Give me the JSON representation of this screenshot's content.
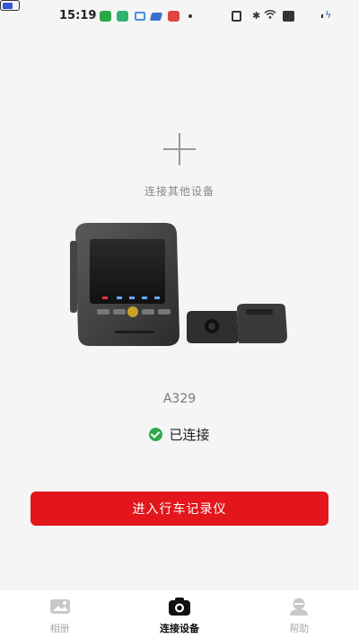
{
  "status_bar": {
    "time": "15:19"
  },
  "add_device": {
    "label": "连接其他设备"
  },
  "device": {
    "model": "A329",
    "status": "已连接"
  },
  "enter_button": {
    "label": "进入行车记录仪"
  },
  "tabs": [
    {
      "label": "相册",
      "icon": "album-icon",
      "active": false
    },
    {
      "label": "连接设备",
      "icon": "camera-icon",
      "active": true
    },
    {
      "label": "帮助",
      "icon": "help-icon",
      "active": false
    }
  ],
  "colors": {
    "accent": "#e2161b",
    "connected": "#2ea84a"
  }
}
